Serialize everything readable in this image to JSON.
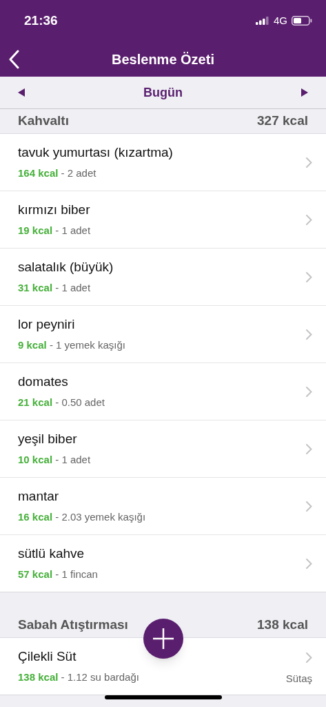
{
  "status_bar": {
    "time": "21:36",
    "network": "4G"
  },
  "nav": {
    "title": "Beslenme Özeti"
  },
  "date_bar": {
    "label": "Bugün"
  },
  "sections": [
    {
      "title": "Kahvaltı",
      "total": "327 kcal",
      "items": [
        {
          "name": "tavuk yumurtası (kızartma)",
          "kcal": "164 kcal",
          "amount": " - 2 adet"
        },
        {
          "name": "kırmızı biber",
          "kcal": "19 kcal",
          "amount": " - 1 adet"
        },
        {
          "name": "salatalık (büyük)",
          "kcal": "31 kcal",
          "amount": " - 1 adet"
        },
        {
          "name": "lor peyniri",
          "kcal": "9 kcal",
          "amount": " - 1 yemek kaşığı"
        },
        {
          "name": "domates",
          "kcal": "21 kcal",
          "amount": " - 0.50 adet"
        },
        {
          "name": "yeşil biber",
          "kcal": "10 kcal",
          "amount": " - 1 adet"
        },
        {
          "name": "mantar",
          "kcal": "16 kcal",
          "amount": " - 2.03 yemek kaşığı"
        },
        {
          "name": "sütlü kahve",
          "kcal": "57 kcal",
          "amount": " - 1 fincan"
        }
      ]
    },
    {
      "title": "Sabah Atıştırması",
      "total": "138 kcal",
      "items": [
        {
          "name": "Çilekli Süt",
          "kcal": "138 kcal",
          "amount": " - 1.12 su bardağı",
          "brand": "Sütaş"
        }
      ]
    }
  ]
}
